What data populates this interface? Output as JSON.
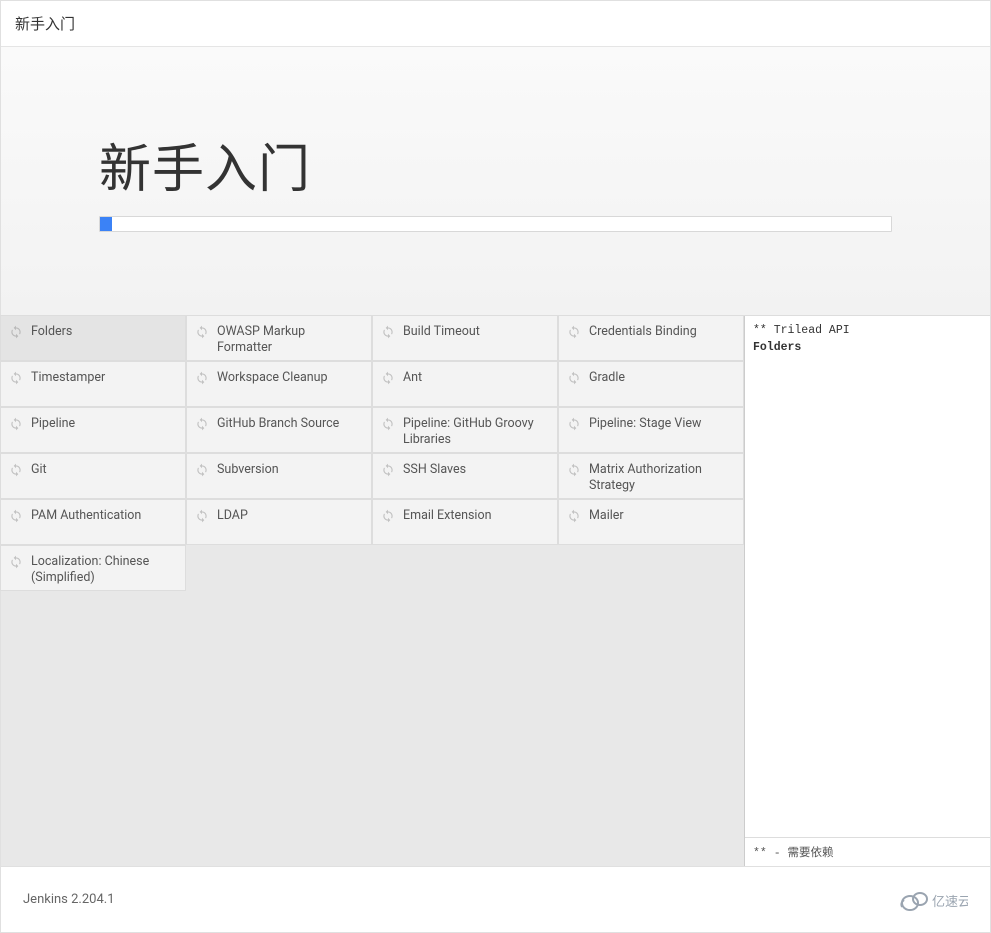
{
  "window": {
    "title": "新手入门"
  },
  "hero": {
    "heading": "新手入门",
    "progress_percent": 1.5
  },
  "plugins": [
    {
      "label": "Folders",
      "active": true
    },
    {
      "label": "OWASP Markup Formatter",
      "active": false
    },
    {
      "label": "Build Timeout",
      "active": false
    },
    {
      "label": "Credentials Binding",
      "active": false
    },
    {
      "label": "Timestamper",
      "active": false
    },
    {
      "label": "Workspace Cleanup",
      "active": false
    },
    {
      "label": "Ant",
      "active": false
    },
    {
      "label": "Gradle",
      "active": false
    },
    {
      "label": "Pipeline",
      "active": false
    },
    {
      "label": "GitHub Branch Source",
      "active": false
    },
    {
      "label": "Pipeline: GitHub Groovy Libraries",
      "active": false
    },
    {
      "label": "Pipeline: Stage View",
      "active": false
    },
    {
      "label": "Git",
      "active": false
    },
    {
      "label": "Subversion",
      "active": false
    },
    {
      "label": "SSH Slaves",
      "active": false
    },
    {
      "label": "Matrix Authorization Strategy",
      "active": false
    },
    {
      "label": "PAM Authentication",
      "active": false
    },
    {
      "label": "LDAP",
      "active": false
    },
    {
      "label": "Email Extension",
      "active": false
    },
    {
      "label": "Mailer",
      "active": false
    },
    {
      "label": "Localization: Chinese (Simplified)",
      "active": false
    }
  ],
  "log": {
    "line1": "** Trilead API",
    "line2": "Folders",
    "footer": "** - 需要依赖"
  },
  "footer": {
    "version": "Jenkins 2.204.1",
    "brand": "亿速云"
  }
}
